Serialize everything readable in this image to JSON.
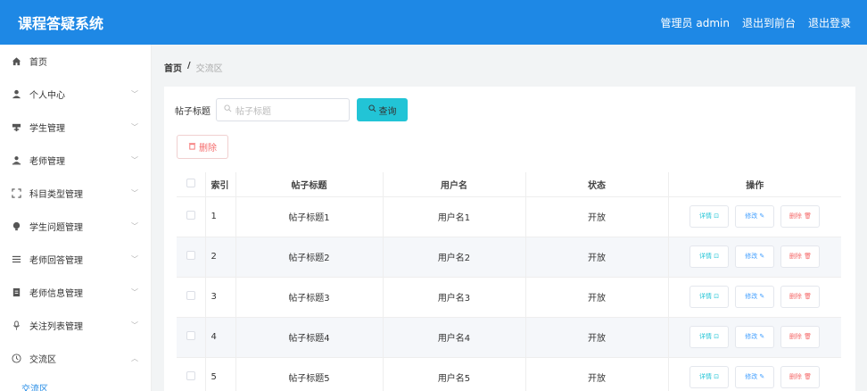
{
  "header": {
    "title": "课程答疑系统",
    "admin": "管理员 admin",
    "to_front": "退出到前台",
    "logout": "退出登录"
  },
  "sidebar": {
    "items": [
      {
        "label": "首页",
        "icon": "home-icon",
        "chevron": false
      },
      {
        "label": "个人中心",
        "icon": "user-icon",
        "chevron": true
      },
      {
        "label": "学生管理",
        "icon": "student-icon",
        "chevron": true
      },
      {
        "label": "老师管理",
        "icon": "teacher-icon",
        "chevron": true
      },
      {
        "label": "科目类型管理",
        "icon": "category-icon",
        "chevron": true
      },
      {
        "label": "学生问题管理",
        "icon": "bulb-icon",
        "chevron": true
      },
      {
        "label": "老师回答管理",
        "icon": "list-icon",
        "chevron": true
      },
      {
        "label": "老师信息管理",
        "icon": "info-icon",
        "chevron": true
      },
      {
        "label": "关注列表管理",
        "icon": "mic-icon",
        "chevron": true
      },
      {
        "label": "交流区",
        "icon": "clock-icon",
        "chevron": true,
        "expanded": true
      }
    ],
    "sub_item": "交流区"
  },
  "breadcrumb": {
    "home": "首页",
    "sep": "/",
    "current": "交流区"
  },
  "search": {
    "label": "帖子标题",
    "placeholder": "帖子标题",
    "button": "查询"
  },
  "delete_button": "删除",
  "table": {
    "headers": [
      "索引",
      "帖子标题",
      "用户名",
      "状态",
      "操作"
    ],
    "rows": [
      {
        "index": "1",
        "title": "帖子标题1",
        "user": "用户名1",
        "status": "开放"
      },
      {
        "index": "2",
        "title": "帖子标题2",
        "user": "用户名2",
        "status": "开放"
      },
      {
        "index": "3",
        "title": "帖子标题3",
        "user": "用户名3",
        "status": "开放"
      },
      {
        "index": "4",
        "title": "帖子标题4",
        "user": "用户名4",
        "status": "开放"
      },
      {
        "index": "5",
        "title": "帖子标题5",
        "user": "用户名5",
        "status": "开放"
      }
    ],
    "actions": {
      "detail": "详情",
      "edit": "修改",
      "delete": "删除"
    }
  },
  "colors": {
    "primary": "#1e88e5",
    "search_button": "#22c4d6",
    "danger": "#f56c6c"
  }
}
